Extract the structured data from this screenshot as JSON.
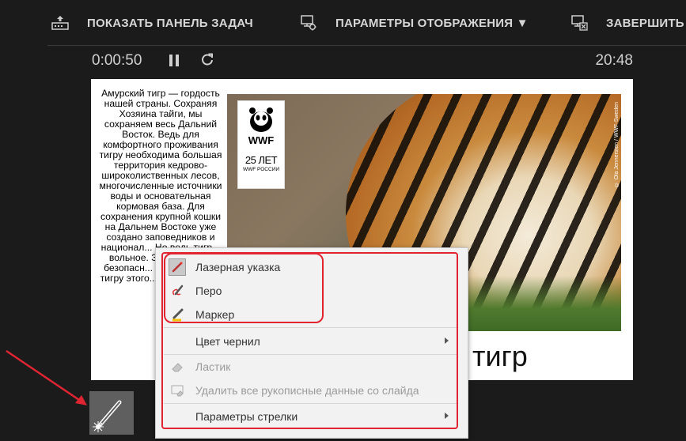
{
  "toolbar": {
    "taskbar_label": "ПОКАЗАТЬ ПАНЕЛЬ ЗАДАЧ",
    "display_label": "ПАРАМЕТРЫ ОТОБРАЖЕНИЯ ▼",
    "end_label": "ЗАВЕРШИТЬ С"
  },
  "presenter": {
    "elapsed": "0:00:50",
    "clock": "20:48"
  },
  "slide": {
    "body_text": "Амурский тигр — гордость нашей страны. Сохраняя Хозяина тайги, мы сохраняем весь Дальний Восток. Ведь для комфортного проживания тигру необходима большая территория кедрово-широколиственных лесов, многочисленные источники воды и основательная кормовая база. Для сохранения крупной кошки на Дальнем Востоке уже создано заповедников и национал... Но ведь тигр... вольное. З... понятно... безопасн... охраняемой... тигру этого... Тигр границ...",
    "logo": {
      "brand": "WWF",
      "years": "25 ЛЕТ",
      "org": "WWF РОССИИ"
    },
    "photo_credit": "© Ola Jennersten / WWF-Sweden",
    "title": "тигр"
  },
  "context_menu": {
    "items": [
      {
        "label": "Лазерная указка",
        "icon": "laser-pointer-icon",
        "selected": true
      },
      {
        "label": "Перо",
        "icon": "pen-icon"
      },
      {
        "label": "Маркер",
        "icon": "highlighter-icon"
      },
      {
        "label": "Цвет чернил",
        "submenu": true
      },
      {
        "label": "Ластик",
        "icon": "eraser-icon",
        "disabled": true
      },
      {
        "label": "Удалить все рукописные данные со слайда",
        "icon": "erase-all-icon",
        "disabled": true
      },
      {
        "label": "Параметры стрелки",
        "submenu": true
      }
    ]
  },
  "colors": {
    "background": "#1b1b1b",
    "menu_bg": "#f2f2f2",
    "highlight_red": "#e02432",
    "pen_tool_bg": "#5f5f5f"
  }
}
